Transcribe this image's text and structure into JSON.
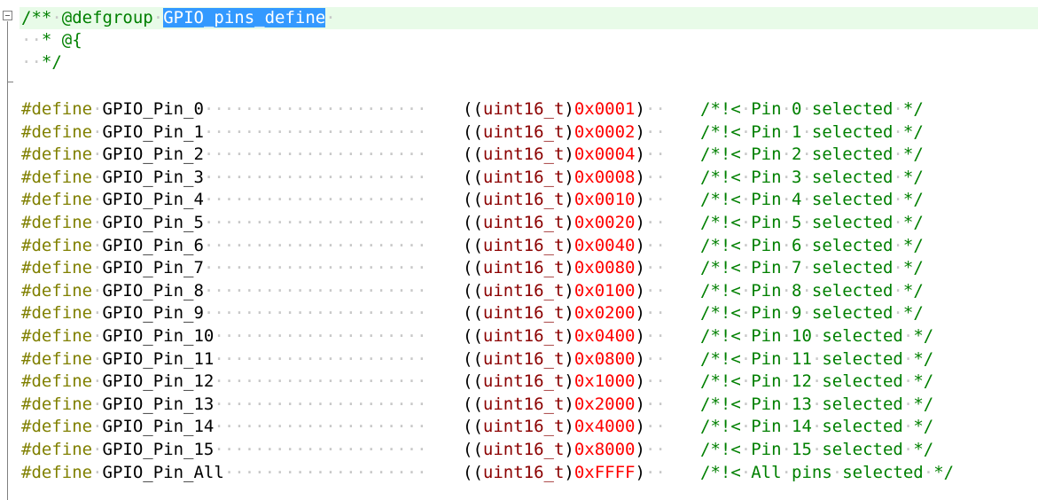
{
  "editor": {
    "header": {
      "comment_open": "/**",
      "tag": "@defgroup",
      "group_name": "GPIO_pins_define",
      "line2": "* @{",
      "line3": "*/"
    },
    "defines": [
      {
        "keyword": "#define",
        "name": "GPIO_Pin_0",
        "cast": "uint16_t",
        "value": "0x0001",
        "comment": "/*!< Pin 0 selected */"
      },
      {
        "keyword": "#define",
        "name": "GPIO_Pin_1",
        "cast": "uint16_t",
        "value": "0x0002",
        "comment": "/*!< Pin 1 selected */"
      },
      {
        "keyword": "#define",
        "name": "GPIO_Pin_2",
        "cast": "uint16_t",
        "value": "0x0004",
        "comment": "/*!< Pin 2 selected */"
      },
      {
        "keyword": "#define",
        "name": "GPIO_Pin_3",
        "cast": "uint16_t",
        "value": "0x0008",
        "comment": "/*!< Pin 3 selected */"
      },
      {
        "keyword": "#define",
        "name": "GPIO_Pin_4",
        "cast": "uint16_t",
        "value": "0x0010",
        "comment": "/*!< Pin 4 selected */"
      },
      {
        "keyword": "#define",
        "name": "GPIO_Pin_5",
        "cast": "uint16_t",
        "value": "0x0020",
        "comment": "/*!< Pin 5 selected */"
      },
      {
        "keyword": "#define",
        "name": "GPIO_Pin_6",
        "cast": "uint16_t",
        "value": "0x0040",
        "comment": "/*!< Pin 6 selected */"
      },
      {
        "keyword": "#define",
        "name": "GPIO_Pin_7",
        "cast": "uint16_t",
        "value": "0x0080",
        "comment": "/*!< Pin 7 selected */"
      },
      {
        "keyword": "#define",
        "name": "GPIO_Pin_8",
        "cast": "uint16_t",
        "value": "0x0100",
        "comment": "/*!< Pin 8 selected */"
      },
      {
        "keyword": "#define",
        "name": "GPIO_Pin_9",
        "cast": "uint16_t",
        "value": "0x0200",
        "comment": "/*!< Pin 9 selected */"
      },
      {
        "keyword": "#define",
        "name": "GPIO_Pin_10",
        "cast": "uint16_t",
        "value": "0x0400",
        "comment": "/*!< Pin 10 selected */"
      },
      {
        "keyword": "#define",
        "name": "GPIO_Pin_11",
        "cast": "uint16_t",
        "value": "0x0800",
        "comment": "/*!< Pin 11 selected */"
      },
      {
        "keyword": "#define",
        "name": "GPIO_Pin_12",
        "cast": "uint16_t",
        "value": "0x1000",
        "comment": "/*!< Pin 12 selected */"
      },
      {
        "keyword": "#define",
        "name": "GPIO_Pin_13",
        "cast": "uint16_t",
        "value": "0x2000",
        "comment": "/*!< Pin 13 selected */"
      },
      {
        "keyword": "#define",
        "name": "GPIO_Pin_14",
        "cast": "uint16_t",
        "value": "0x4000",
        "comment": "/*!< Pin 14 selected */"
      },
      {
        "keyword": "#define",
        "name": "GPIO_Pin_15",
        "cast": "uint16_t",
        "value": "0x8000",
        "comment": "/*!< Pin 15 selected */"
      },
      {
        "keyword": "#define",
        "name": "GPIO_Pin_All",
        "cast": "uint16_t",
        "value": "0xFFFF",
        "comment": "/*!< All pins selected */"
      }
    ],
    "colors": {
      "keyword": "#808000",
      "comment": "#008000",
      "type": "#8b0000",
      "number": "#ff0000",
      "selection": "#3399ff",
      "current_line": "#e8fbe8"
    }
  }
}
